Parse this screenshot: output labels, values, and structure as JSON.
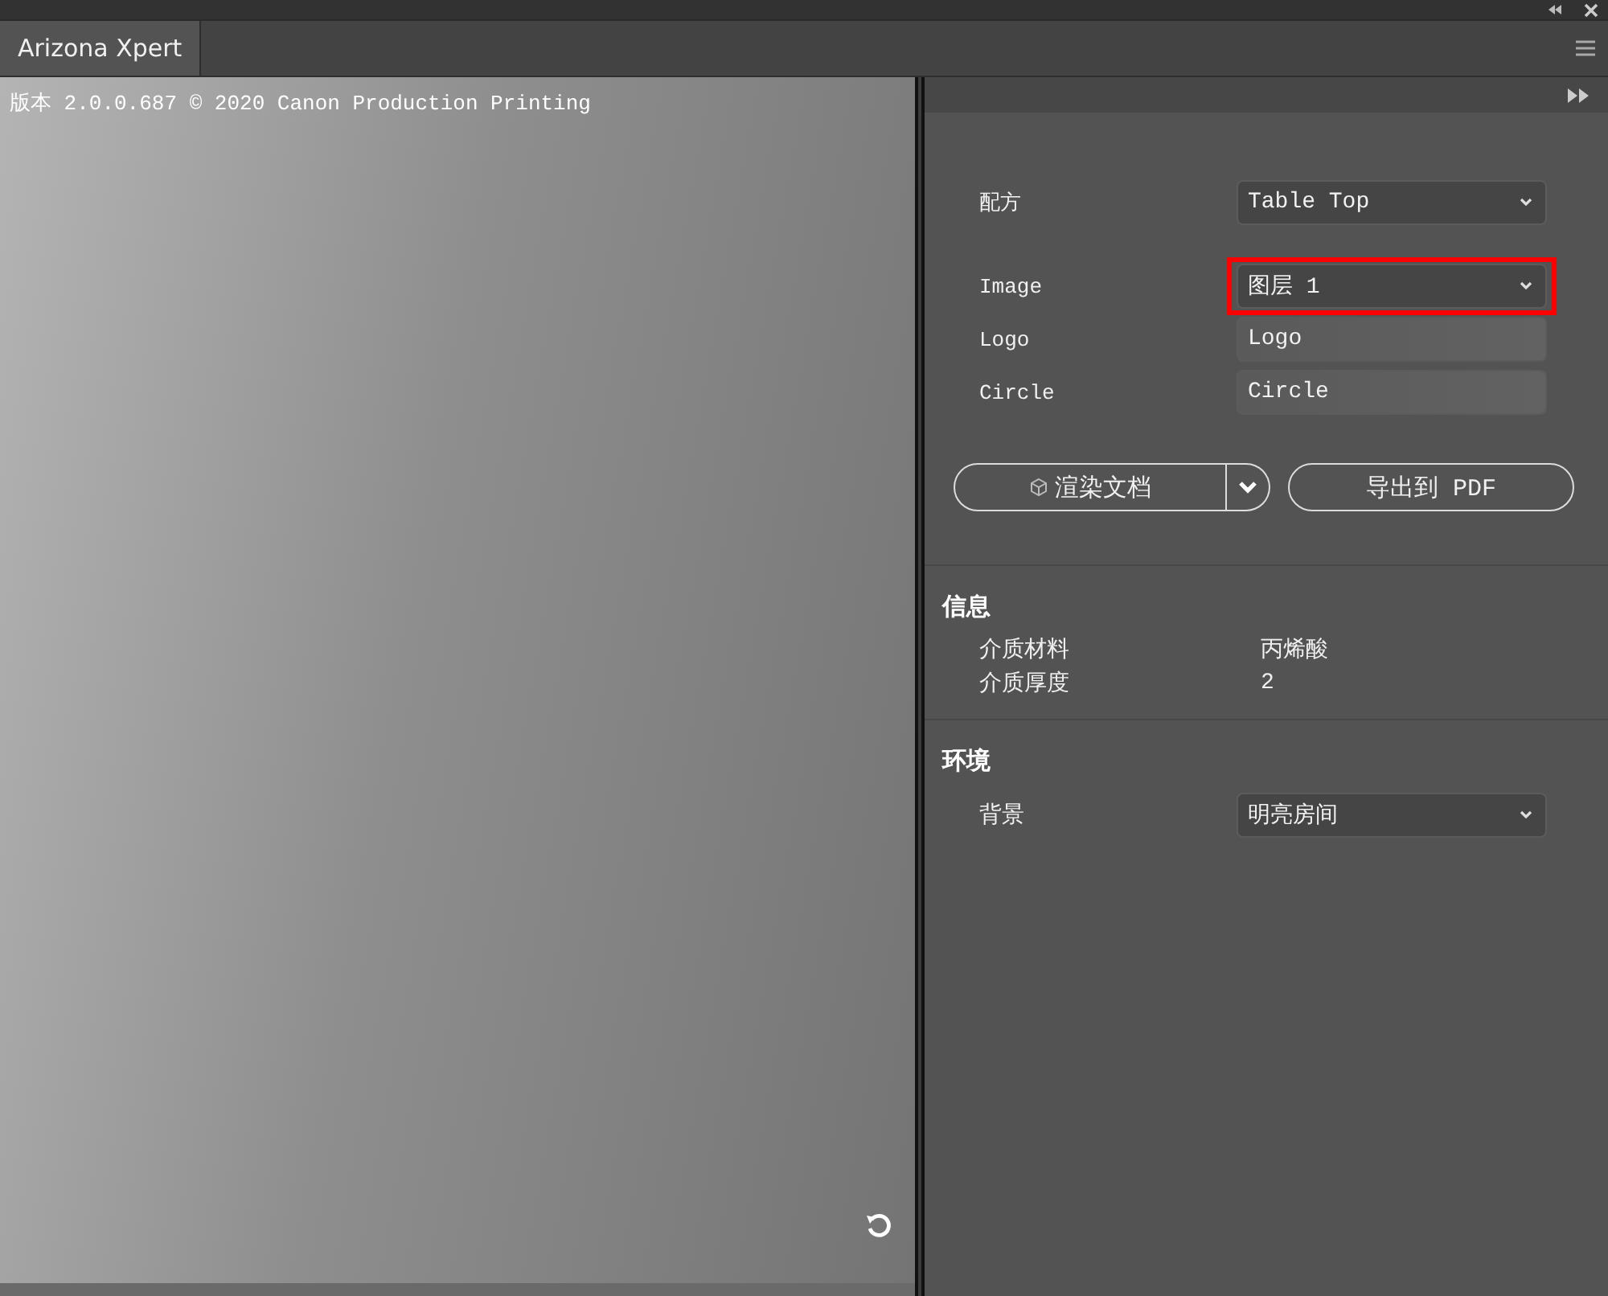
{
  "window": {
    "title": "Arizona Xpert"
  },
  "viewport": {
    "version_text": "版本 2.0.0.687 © 2020 Canon Production Printing"
  },
  "settings": [
    {
      "label": "配方",
      "kind": "select",
      "value": "Table Top",
      "highlighted": false
    },
    {
      "label": "Image",
      "kind": "select",
      "value": "图层 1",
      "highlighted": true
    },
    {
      "label": "Logo",
      "kind": "field",
      "value": "Logo",
      "highlighted": false
    },
    {
      "label": "Circle",
      "kind": "field",
      "value": "Circle",
      "highlighted": false
    }
  ],
  "actions": {
    "render": "渲染文档",
    "export": "导出到 PDF"
  },
  "info": {
    "title": "信息",
    "rows": [
      {
        "label": "介质材料",
        "value": "丙烯酸"
      },
      {
        "label": "介质厚度",
        "value": "2"
      }
    ]
  },
  "environment": {
    "title": "环境",
    "rows": [
      {
        "label": "背景",
        "kind": "select",
        "value": "明亮房间"
      }
    ]
  }
}
